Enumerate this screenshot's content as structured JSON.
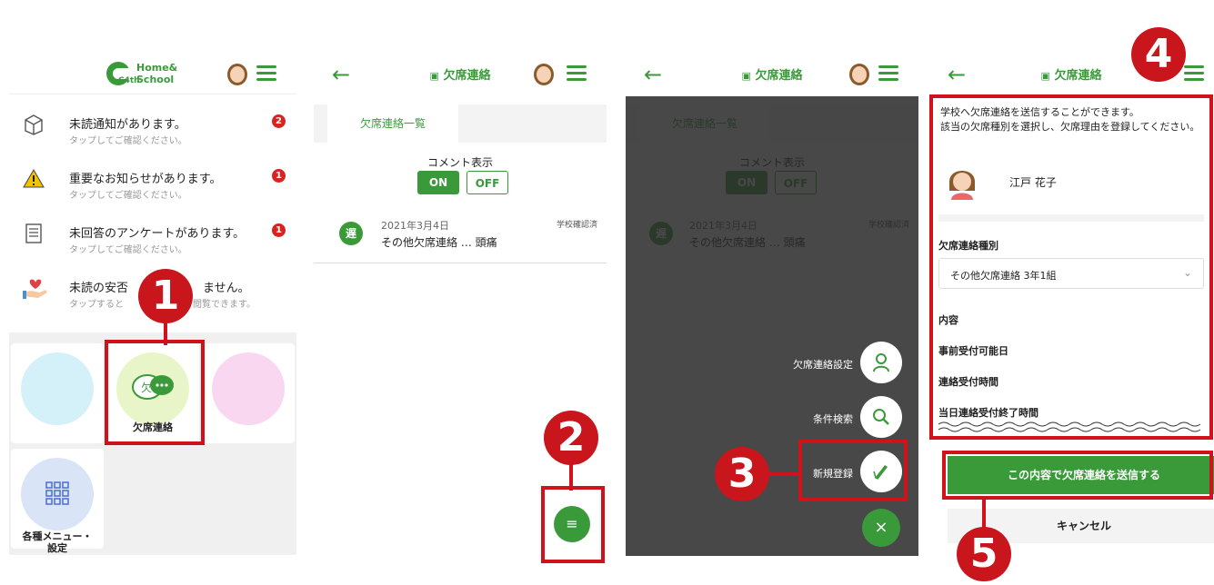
{
  "screen1": {
    "logo": "Home&\nSchool",
    "logo_sub": "C4th",
    "notifications": [
      {
        "main": "未読通知があります。",
        "sub": "タップしてご確認ください。",
        "badge": "2",
        "icon": "box-icon"
      },
      {
        "main": "重要なお知らせがあります。",
        "sub": "タップしてご確認ください。",
        "badge": "1",
        "icon": "warning-icon"
      },
      {
        "main": "未回答のアンケートがあります。",
        "sub": "タップしてご確認ください。",
        "badge": "1",
        "icon": "survey-icon"
      },
      {
        "main": "未読の安否",
        "main2": "ません。",
        "sub": "タップすると",
        "sub2": "を閲覧できます。",
        "icon": "heart-hand-icon"
      }
    ],
    "tiles": {
      "absence": "欠席連絡",
      "menu": "各種メニュー・\n設定"
    }
  },
  "screen2": {
    "title": "欠席連絡",
    "tab": "欠席連絡一覧",
    "comment_label": "コメント表示",
    "on": "ON",
    "off": "OFF",
    "item": {
      "badge": "遅",
      "date": "2021年3月4日",
      "status": "学校確認済",
      "content": "その他欠席連絡 … 頭痛"
    }
  },
  "screen3": {
    "title": "欠席連絡",
    "fab_settings": "欠席連絡設定",
    "fab_search": "条件検索",
    "fab_new": "新規登録"
  },
  "screen4": {
    "title": "欠席連絡",
    "intro": "学校へ欠席連絡を送信することができます。\n該当の欠席種別を選択し、欠席理由を登録してください。",
    "student": "江戸 花子",
    "type_label": "欠席連絡種別",
    "type_value": "その他欠席連絡 3年1組",
    "content": "内容",
    "advance": "事前受付可能日",
    "time": "連絡受付時間",
    "end": "当日連絡受付終了時間",
    "submit": "この内容で欠席連絡を送信する",
    "cancel": "キャンセル"
  },
  "steps": [
    "1",
    "2",
    "3",
    "4",
    "5"
  ],
  "colors": {
    "accent": "#3a9a3a",
    "callout": "#d0121b",
    "badge": "#d9231f"
  }
}
